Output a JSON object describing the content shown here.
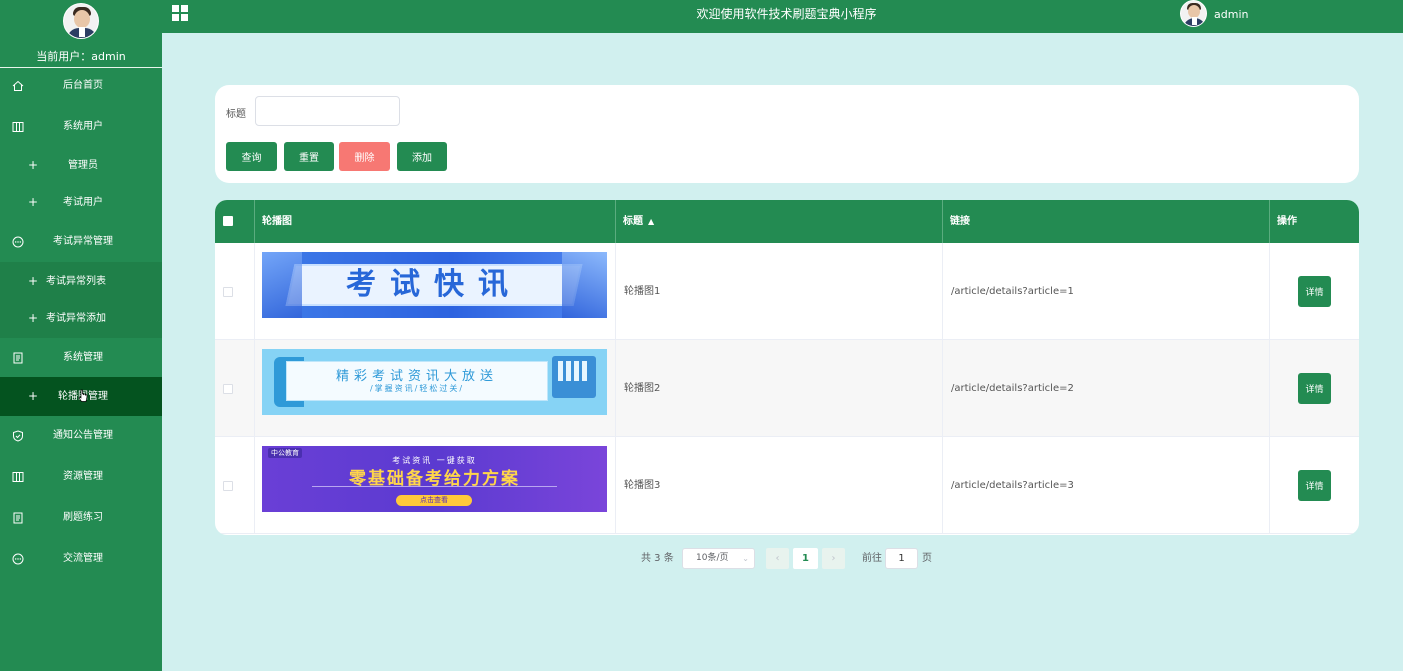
{
  "header": {
    "title": "欢迎使用软件技术刷题宝典小程序",
    "username": "admin"
  },
  "sidebar": {
    "current_user_label": "当前用户：",
    "current_user": "admin",
    "items": [
      {
        "label": "后台首页",
        "icon": "home-icon"
      },
      {
        "label": "系统用户",
        "icon": "columns-icon"
      },
      {
        "label": "管理员",
        "icon": "plus-icon"
      },
      {
        "label": "考试用户",
        "icon": "plus-icon"
      },
      {
        "label": "考试异常管理",
        "icon": "chat-icon"
      },
      {
        "label": "考试异常列表",
        "icon": "plus-icon"
      },
      {
        "label": "考试异常添加",
        "icon": "plus-icon"
      },
      {
        "label": "系统管理",
        "icon": "document-icon"
      },
      {
        "label": "轮播图管理",
        "icon": "plus-icon"
      },
      {
        "label": "通知公告管理",
        "icon": "shield-check-icon"
      },
      {
        "label": "资源管理",
        "icon": "columns-icon"
      },
      {
        "label": "刷题练习",
        "icon": "document-icon"
      },
      {
        "label": "交流管理",
        "icon": "chat-icon"
      }
    ]
  },
  "search": {
    "title_label": "标题",
    "title_value": "",
    "query_label": "查询",
    "reset_label": "重置",
    "delete_label": "删除",
    "add_label": "添加"
  },
  "table": {
    "columns": [
      "轮播图",
      "标题",
      "链接",
      "操作"
    ],
    "rows": [
      {
        "banner_text": "考试快讯",
        "title": "轮播图1",
        "link": "/article/details?article=1",
        "action": "详情"
      },
      {
        "banner_text": "精彩考试资讯大放送",
        "banner_sub": "/掌握资讯/轻松过关/",
        "title": "轮播图2",
        "link": "/article/details?article=2",
        "action": "详情"
      },
      {
        "banner_logo": "中公教育",
        "banner_top": "考试资讯 一键获取",
        "banner_text": "零基础备考给力方案",
        "banner_button": "点击查看",
        "title": "轮播图3",
        "link": "/article/details?article=3",
        "action": "详情"
      }
    ]
  },
  "pagination": {
    "total": "共 3 条",
    "page_size": "10条/页",
    "current_page": "1",
    "goto_label": "前往",
    "goto_value": "1",
    "page_suffix": "页"
  },
  "colors": {
    "primary": "#238b52",
    "active_menu": "#04531f",
    "danger": "#f77873",
    "background": "#d1f0ef"
  }
}
